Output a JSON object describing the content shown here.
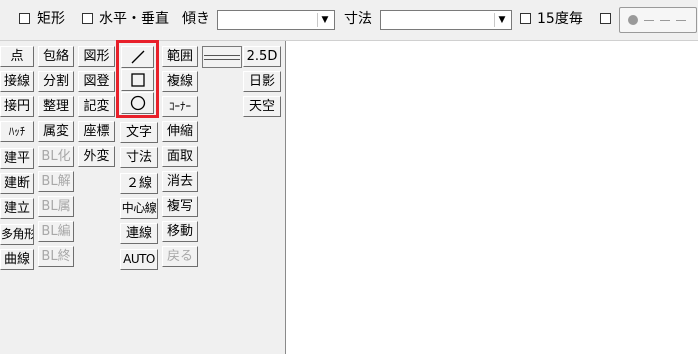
{
  "toolbar": {
    "rect_label": "矩形",
    "hv_label": "水平・垂直",
    "angle_label": "傾き",
    "angle_value": "",
    "dim_label": "寸法",
    "dim_value": "",
    "deg15_label": "15度毎"
  },
  "tools": {
    "col1": [
      "点",
      "接線",
      "接円",
      "ﾊｯﾁ",
      "建平",
      "建断",
      "建立",
      "多角形",
      "曲線"
    ],
    "col2": [
      "包絡",
      "分割",
      "整理",
      "属変",
      "BL化",
      "BL解",
      "BL属",
      "BL編",
      "BL終"
    ],
    "col3": [
      "図形",
      "図登",
      "記変",
      "座標",
      "外変"
    ],
    "col4": [
      "文字",
      "寸法",
      "２線",
      "中心線",
      "連線",
      "AUTO"
    ],
    "col5": [
      "範囲",
      "複線",
      "ｺｰﾅｰ",
      "伸縮",
      "面取",
      "消去",
      "複写",
      "移動",
      "戻る"
    ],
    "col6": [
      "2.5D",
      "日影",
      "天空"
    ]
  },
  "shapes": {
    "line": "／",
    "rect": "□",
    "circle": "○"
  },
  "colors": {
    "highlight": "#e8202a"
  }
}
